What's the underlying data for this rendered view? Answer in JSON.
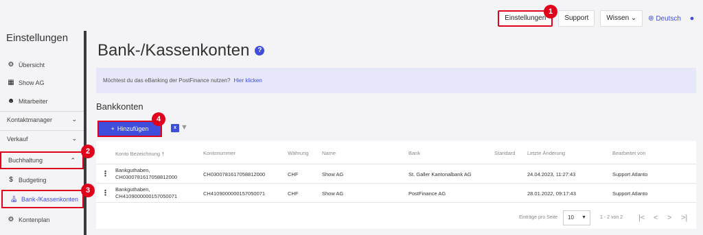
{
  "topnav": {
    "settings_label": "Einstellungen",
    "support_label": "Support",
    "knowledge_label": "Wissen",
    "language_label": "Deutsch"
  },
  "markers": [
    "1",
    "2",
    "3",
    "4"
  ],
  "sidebar": {
    "title": "Einstellungen",
    "items": [
      {
        "label": "Übersicht",
        "icon": "gear-icon"
      },
      {
        "label": "Show AG",
        "icon": "building-icon"
      },
      {
        "label": "Mitarbeiter",
        "icon": "people-icon"
      },
      {
        "label": "Kontaktmanager",
        "icon": "chevron-down-icon"
      },
      {
        "label": "Verkauf",
        "icon": "chevron-down-icon"
      },
      {
        "label": "Buchhaltung",
        "icon": "chevron-up-icon"
      },
      {
        "label": "Budgeting",
        "icon": "dollar-icon"
      },
      {
        "label": "Bank-/Kassenkonten",
        "icon": "bank-icon"
      },
      {
        "label": "Kontenplan",
        "icon": "tree-icon"
      }
    ]
  },
  "main": {
    "title": "Bank-/Kassenkonten",
    "banner_text": "Möchtest du das eBanking der PostFinance nutzen?",
    "banner_link": "Hier klicken",
    "section_title": "Bankkonten",
    "add_label": "Hinzufügen"
  },
  "table": {
    "columns": [
      "Konto Bezeichnung",
      "Kontonummer",
      "Währung",
      "Name",
      "Bank",
      "Standard",
      "Letzte Änderung",
      "Bearbeitet von"
    ],
    "rows": [
      {
        "bezeichnung_1": "Bankguthaben,",
        "bezeichnung_2": "CH0300781617058812000",
        "kontonummer": "CH0300781617058812000",
        "waehrung": "CHF",
        "name": "Show AG",
        "bank": "St. Galler Kantonalbank AG",
        "standard": "",
        "geaendert": "24.04.2023, 11:27:43",
        "bearbeitet": "Support Atlanto"
      },
      {
        "bezeichnung_1": "Bankguthaben,",
        "bezeichnung_2": "CH4109000000157050071",
        "kontonummer": "CH4109000000157050071",
        "waehrung": "CHF",
        "name": "Show AG",
        "bank": "PostFinance AG",
        "standard": "",
        "geaendert": "28.01.2022, 09:17:43",
        "bearbeitet": "Support Atlanto"
      }
    ],
    "pager": {
      "label": "Einträge pro Seite",
      "page_size": "10",
      "range": "1 - 2 von 2"
    }
  },
  "colors": {
    "accent": "#3e4ddb",
    "highlight": "#e0001b",
    "banner": "#e6e7f8"
  }
}
